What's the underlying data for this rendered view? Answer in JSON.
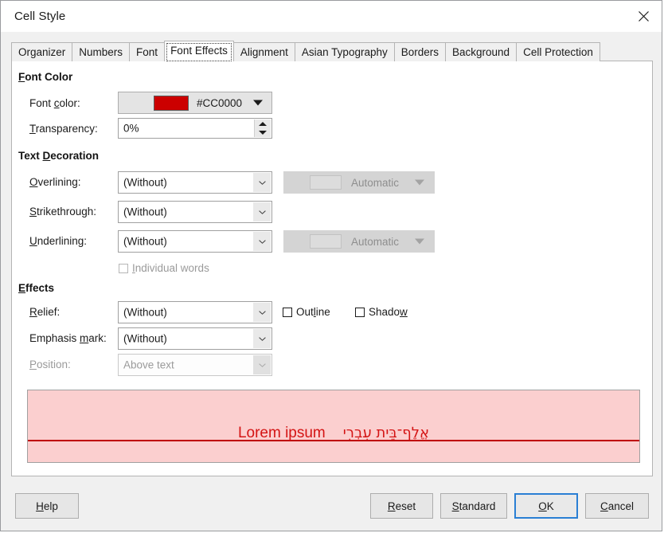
{
  "window": {
    "title": "Cell Style",
    "close_icon": "close-icon"
  },
  "tabs": [
    {
      "label": "Organizer",
      "active": false
    },
    {
      "label": "Numbers",
      "active": false
    },
    {
      "label": "Font",
      "active": false
    },
    {
      "label": "Font Effects",
      "active": true
    },
    {
      "label": "Alignment",
      "active": false
    },
    {
      "label": "Asian Typography",
      "active": false
    },
    {
      "label": "Borders",
      "active": false
    },
    {
      "label": "Background",
      "active": false
    },
    {
      "label": "Cell Protection",
      "active": false
    }
  ],
  "font_color_group": {
    "title": "Font Color",
    "title_acc": "F",
    "font_color": {
      "label": "Font color:",
      "label_acc": "c",
      "value": "#CC0000",
      "swatch_hex": "#CC0000"
    },
    "transparency": {
      "label": "Transparency:",
      "label_acc": "T",
      "value": "0%"
    }
  },
  "text_decoration_group": {
    "title": "Text Decoration",
    "title_acc": "D",
    "overlining": {
      "label": "Overlining:",
      "label_acc": "O",
      "value": "(Without)",
      "color_value": "Automatic",
      "color_enabled": false
    },
    "strikethrough": {
      "label": "Strikethrough:",
      "label_acc": "S",
      "value": "(Without)"
    },
    "underlining": {
      "label": "Underlining:",
      "label_acc": "U",
      "value": "(Without)",
      "color_value": "Automatic",
      "color_enabled": false
    },
    "individual_words": {
      "label": "Individual words",
      "label_acc": "I",
      "checked": false,
      "enabled": false
    }
  },
  "effects_group": {
    "title": "Effects",
    "title_acc": "E",
    "relief": {
      "label": "Relief:",
      "label_acc": "R",
      "value": "(Without)"
    },
    "outline": {
      "label_pre": "Out",
      "label_acc": "l",
      "label_post": "ine",
      "checked": false
    },
    "shadow": {
      "label_pre": "Shado",
      "label_acc": "w",
      "label_post": "",
      "checked": false
    },
    "emphasis_mark": {
      "label_pre": "Emphasis ",
      "label_acc": "m",
      "label_post": "ark:",
      "value": "(Without)"
    },
    "position": {
      "label": "Position:",
      "label_acc": "P",
      "value": "Above text",
      "enabled": false
    }
  },
  "preview": {
    "latin_text": "Lorem ipsum",
    "hebrew_text": "אֱלֶף־בֵּית עִבְרִי",
    "text_color": "#D41414",
    "background_color": "#FBCFCF",
    "rule_color": "#BF0000"
  },
  "buttons": {
    "help": {
      "label_pre": "",
      "label_acc": "H",
      "label_post": "elp"
    },
    "reset": {
      "label_pre": "",
      "label_acc": "R",
      "label_post": "eset"
    },
    "standard": {
      "label_pre": "",
      "label_acc": "S",
      "label_post": "tandard"
    },
    "ok": {
      "label_pre": "",
      "label_acc": "O",
      "label_post": "K",
      "default": true
    },
    "cancel": {
      "label_pre": "",
      "label_acc": "C",
      "label_post": "ancel"
    }
  }
}
